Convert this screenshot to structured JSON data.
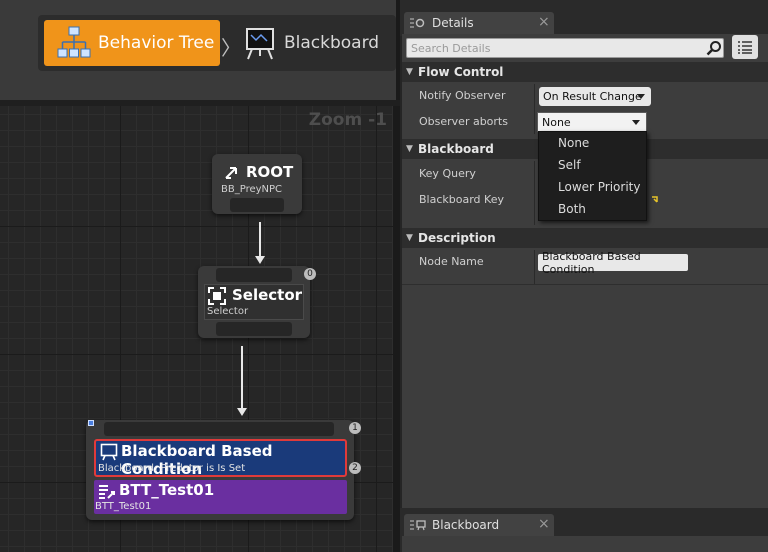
{
  "toolbar": {
    "behavior_tree_label": "Behavior Tree",
    "blackboard_label": "Blackboard",
    "chevron": "〉"
  },
  "graph": {
    "zoom_label": "Zoom -1",
    "root": {
      "title": "ROOT",
      "subtitle": "BB_PreyNPC"
    },
    "selector": {
      "title": "Selector",
      "subtitle": "Selector",
      "index": "0"
    },
    "condition": {
      "title": "Blackboard Based Condition",
      "subtitle": "Blackboard: Predator is Is Set",
      "index": "2"
    },
    "task": {
      "title": "BTT_Test01",
      "subtitle": "BTT_Test01"
    },
    "sequence_index": "1"
  },
  "details": {
    "tab_label": "Details",
    "close_glyph": "×",
    "search_placeholder": "Search Details",
    "categories": {
      "flow_control": "Flow Control",
      "blackboard": "Blackboard",
      "description": "Description"
    },
    "rows": {
      "notify_observer": {
        "label": "Notify Observer",
        "value": "On Result Change"
      },
      "observer_aborts": {
        "label": "Observer aborts",
        "value": "None"
      },
      "key_query": {
        "label": "Key Query"
      },
      "blackboard_key": {
        "label": "Blackboard Key"
      },
      "node_name": {
        "label": "Node Name",
        "value": "Blackboard Based Condition"
      }
    },
    "observer_aborts_options": [
      "None",
      "Self",
      "Lower Priority",
      "Both"
    ]
  },
  "blackboard_panel": {
    "tab_label": "Blackboard",
    "close_glyph": "×"
  },
  "colors": {
    "accent_orange": "#f0941a",
    "condition_blue": "#1a3a7a",
    "condition_border": "#e03a3a",
    "task_purple": "#6a2fa0"
  }
}
